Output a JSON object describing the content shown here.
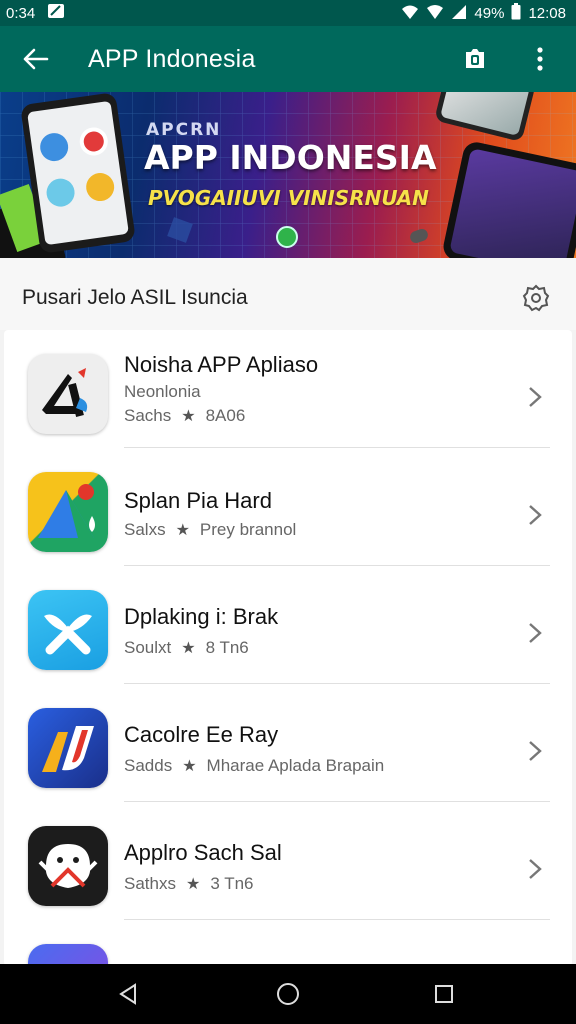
{
  "status_bar": {
    "time": "0:34",
    "battery": "49%",
    "clock": "12:08"
  },
  "app_bar": {
    "title": "APP Indonesia"
  },
  "banner": {
    "small_text": "APCRN",
    "title": "APP INDONESIA",
    "subtitle": "PVOGAIIUVI VINISRNUAN"
  },
  "section": {
    "title": "Pusari Jelo ASIL Isuncia"
  },
  "apps": [
    {
      "name": "Noisha APP Apliaso",
      "subtitle": "Neonlonia",
      "meta_left": "Sachs",
      "meta_right": "8A06"
    },
    {
      "name": "Splan Pia Hard",
      "subtitle": "",
      "meta_left": "Salxs",
      "meta_right": "Prey brannol"
    },
    {
      "name": "Dplaking i: Brak",
      "subtitle": "",
      "meta_left": "Soulxt",
      "meta_right": "8 Tn6"
    },
    {
      "name": "Cacolre Ee Ray",
      "subtitle": "",
      "meta_left": "Sadds",
      "meta_right": "Mharae Aplada Brapain"
    },
    {
      "name": "Applro Sach Sal",
      "subtitle": "",
      "meta_left": "Sathxs",
      "meta_right": "3 Tn6"
    }
  ],
  "colors": {
    "app_bar": "#00695c",
    "status_bar": "#00574d"
  }
}
